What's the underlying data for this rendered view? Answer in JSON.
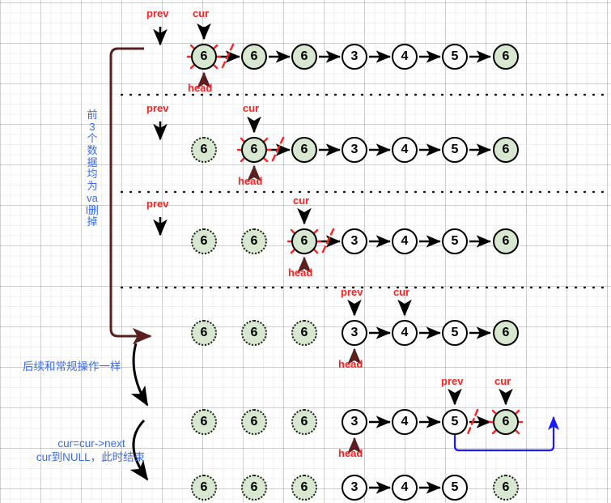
{
  "diagram": {
    "title": "Linked list remove-elements walkthrough",
    "colors": {
      "pointer_label": "#ff2020",
      "annotation": "#3d6be5",
      "node_value_fill": "#d8e8d0",
      "node_plain_fill": "#ffffff",
      "delete_mark": "#ff2020",
      "brown_arrow": "#5a1f1f",
      "black_arrow": "#000000",
      "blue_arrow": "#1a1aff",
      "grid": "#e8e8e8"
    },
    "annotations": [
      {
        "name": "vertical-note",
        "text": "前3个数据均为val删掉"
      },
      {
        "name": "normal-ops-note",
        "text": "后续和常规操作一样"
      },
      {
        "name": "cur-next-note-line1",
        "text": "cur=cur->next"
      },
      {
        "name": "cur-next-note-line2",
        "text": "cur到NULL，此时结束"
      }
    ],
    "pointer_labels": {
      "prev": "prev",
      "cur": "cur",
      "head": "head"
    },
    "rows": [
      {
        "id": "row-1",
        "nodes": [
          {
            "value": "6",
            "state": "deleting",
            "green": true
          },
          {
            "value": "6",
            "state": "active",
            "green": true
          },
          {
            "value": "6",
            "state": "active",
            "green": true
          },
          {
            "value": "3",
            "state": "active",
            "green": false
          },
          {
            "value": "4",
            "state": "active",
            "green": false
          },
          {
            "value": "5",
            "state": "active",
            "green": false
          },
          {
            "value": "6",
            "state": "active",
            "green": true
          }
        ],
        "pointers": [
          {
            "name": "prev",
            "label": "prev",
            "target": "none"
          },
          {
            "name": "cur",
            "label": "cur",
            "target": "node-0"
          },
          {
            "name": "head",
            "label": "head",
            "target": "node-0"
          }
        ]
      },
      {
        "id": "row-2",
        "nodes": [
          {
            "value": "6",
            "state": "deleted",
            "green": true
          },
          {
            "value": "6",
            "state": "deleting",
            "green": true
          },
          {
            "value": "6",
            "state": "active",
            "green": true
          },
          {
            "value": "3",
            "state": "active",
            "green": false
          },
          {
            "value": "4",
            "state": "active",
            "green": false
          },
          {
            "value": "5",
            "state": "active",
            "green": false
          },
          {
            "value": "6",
            "state": "active",
            "green": true
          }
        ],
        "pointers": [
          {
            "name": "prev",
            "label": "prev",
            "target": "none"
          },
          {
            "name": "cur",
            "label": "cur",
            "target": "node-1"
          },
          {
            "name": "head",
            "label": "head",
            "target": "node-1"
          }
        ]
      },
      {
        "id": "row-3",
        "nodes": [
          {
            "value": "6",
            "state": "deleted",
            "green": true
          },
          {
            "value": "6",
            "state": "deleted",
            "green": true
          },
          {
            "value": "6",
            "state": "deleting",
            "green": true
          },
          {
            "value": "3",
            "state": "active",
            "green": false
          },
          {
            "value": "4",
            "state": "active",
            "green": false
          },
          {
            "value": "5",
            "state": "active",
            "green": false
          },
          {
            "value": "6",
            "state": "active",
            "green": true
          }
        ],
        "pointers": [
          {
            "name": "prev",
            "label": "prev",
            "target": "none"
          },
          {
            "name": "cur",
            "label": "cur",
            "target": "node-2"
          },
          {
            "name": "head",
            "label": "head",
            "target": "node-2"
          }
        ]
      },
      {
        "id": "row-4",
        "nodes": [
          {
            "value": "6",
            "state": "deleted",
            "green": true
          },
          {
            "value": "6",
            "state": "deleted",
            "green": true
          },
          {
            "value": "6",
            "state": "deleted",
            "green": true
          },
          {
            "value": "3",
            "state": "active",
            "green": false
          },
          {
            "value": "4",
            "state": "active",
            "green": false
          },
          {
            "value": "5",
            "state": "active",
            "green": false
          },
          {
            "value": "6",
            "state": "active",
            "green": true
          }
        ],
        "pointers": [
          {
            "name": "prev",
            "label": "prev",
            "target": "node-3"
          },
          {
            "name": "cur",
            "label": "cur",
            "target": "node-4"
          },
          {
            "name": "head",
            "label": "head",
            "target": "node-3"
          }
        ]
      },
      {
        "id": "row-5",
        "nodes": [
          {
            "value": "6",
            "state": "deleted",
            "green": true
          },
          {
            "value": "6",
            "state": "deleted",
            "green": true
          },
          {
            "value": "6",
            "state": "deleted",
            "green": true
          },
          {
            "value": "3",
            "state": "active",
            "green": false
          },
          {
            "value": "4",
            "state": "active",
            "green": false
          },
          {
            "value": "5",
            "state": "active",
            "green": false
          },
          {
            "value": "6",
            "state": "deleting",
            "green": true
          }
        ],
        "pointers": [
          {
            "name": "prev",
            "label": "prev",
            "target": "node-5"
          },
          {
            "name": "cur",
            "label": "cur",
            "target": "node-6"
          },
          {
            "name": "head",
            "label": "head",
            "target": "node-3"
          }
        ]
      },
      {
        "id": "row-6",
        "nodes": [
          {
            "value": "6",
            "state": "deleted",
            "green": true
          },
          {
            "value": "6",
            "state": "deleted",
            "green": true
          },
          {
            "value": "6",
            "state": "deleted",
            "green": true
          },
          {
            "value": "3",
            "state": "active",
            "green": false
          },
          {
            "value": "4",
            "state": "active",
            "green": false
          },
          {
            "value": "5",
            "state": "active",
            "green": false
          },
          {
            "value": "6",
            "state": "deleted",
            "green": true
          }
        ],
        "pointers": []
      }
    ]
  }
}
